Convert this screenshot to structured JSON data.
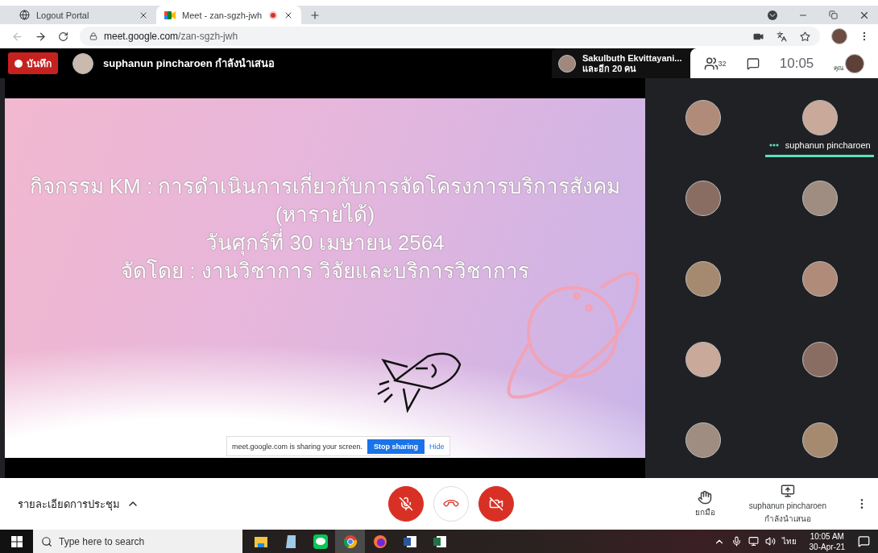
{
  "browser": {
    "tabs": [
      {
        "title": "Logout Portal",
        "selected": false,
        "recording": false
      },
      {
        "title": "Meet - zan-sgzh-jwh",
        "selected": true,
        "recording": true
      }
    ],
    "url_host": "meet.google.com",
    "url_path": "/zan-sgzh-jwh"
  },
  "meeting_bar": {
    "record_label": "บันทึก",
    "presenter": "suphanun pincharoen กำลังนำเสนอ",
    "speaker_name": "Sakulbuth Ekvittayani...",
    "speaker_more": "และอีก 20 คน",
    "participant_count": "32",
    "time": "10:05",
    "self_label": "คุณ"
  },
  "slide": {
    "lines": [
      "กิจกรรม KM : การดำเนินการเกี่ยวกับการจัดโครงการบริการสังคม",
      "(หารายได้)",
      "วันศุกร์ที่ 30 เมษายน 2564",
      "จัดโดย : งานวิชาการ วิจัยและบริการวิชาการ"
    ],
    "share_notice": {
      "text": "meet.google.com is sharing your screen.",
      "stop": "Stop sharing",
      "hide": "Hide"
    }
  },
  "participants": [
    {
      "speaking": false
    },
    {
      "name": "suphanun pincharoen",
      "speaking": true
    },
    {
      "speaking": false
    },
    {
      "speaking": false
    },
    {
      "speaking": false
    },
    {
      "speaking": false
    },
    {
      "speaking": false
    },
    {
      "speaking": false
    },
    {
      "speaking": false
    },
    {
      "speaking": false
    }
  ],
  "controls": {
    "details": "รายละเอียดการประชุม",
    "mic_muted": true,
    "camera_off": true,
    "raise_hand": "ยกมือ",
    "presenting_name": "suphanun pincharoen",
    "presenting_status": "กำลังนำเสนอ"
  },
  "taskbar": {
    "search_placeholder": "Type here to search",
    "apps": [
      {
        "kind": "explorer",
        "active": false
      },
      {
        "kind": "notepad",
        "active": false
      },
      {
        "kind": "line",
        "active": false
      },
      {
        "kind": "chrome",
        "active": true
      },
      {
        "kind": "firefox",
        "active": false
      },
      {
        "kind": "word",
        "active": false
      },
      {
        "kind": "excel",
        "active": false
      }
    ],
    "language": "ไทย",
    "time": "10:05 AM",
    "date": "30-Apr-21"
  }
}
